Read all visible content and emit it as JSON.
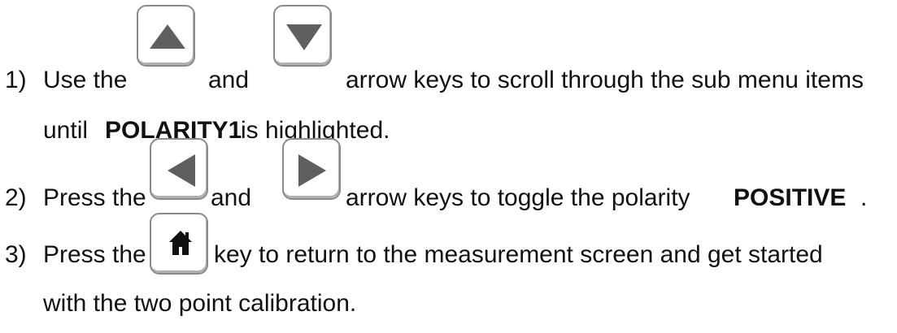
{
  "steps": [
    {
      "number": "1)",
      "text_before_key1": "Use the",
      "key1_icon": "up-arrow-icon",
      "text_between": "and",
      "key2_icon": "down-arrow-icon",
      "text_after": "arrow keys to scroll through the sub menu items",
      "line2_before": "until",
      "line2_bold": "POLARITY1",
      "line2_after": "is highlighted."
    },
    {
      "number": "2)",
      "text_before_key1": "Press the",
      "key1_icon": "left-arrow-icon",
      "text_between": "and",
      "key2_icon": "right-arrow-icon",
      "text_after": "arrow keys to toggle the polarity",
      "bold_end": "POSITIVE",
      "period": "."
    },
    {
      "number": "3)",
      "text_before_key1": "Press the",
      "key1_icon": "home-icon",
      "text_after": "key to return to the measurement screen and get started",
      "line2": "with the two point calibration."
    }
  ],
  "icon_color": "#5f5f5f",
  "key_border_color": "#8a8a8a"
}
